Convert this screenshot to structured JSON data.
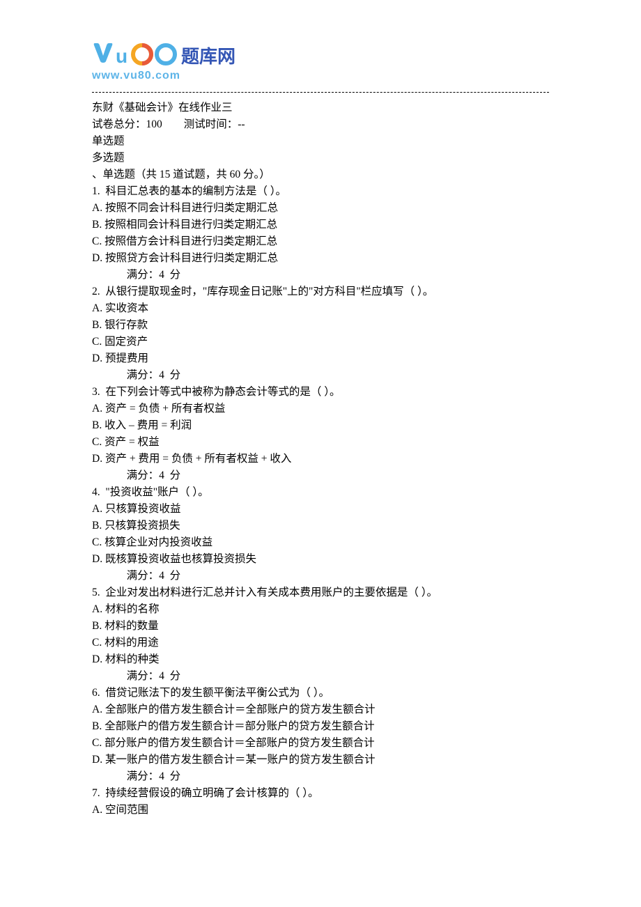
{
  "logo": {
    "text_cn": "题库网",
    "domain": "www.vu80.com"
  },
  "header": {
    "title": "东财《基础会计》在线作业三",
    "score_label": "试卷总分：100",
    "time_label": "测试时间：--",
    "single_choice_label": "单选题",
    "multi_choice_label": "多选题",
    "section_header": "、单选题（共 15 道试题，共 60 分。）"
  },
  "questions": [
    {
      "stem": "1.  科目汇总表的基本的编制方法是（ ）。",
      "options": [
        "A. 按照不同会计科目进行归类定期汇总",
        "B. 按照相同会计科目进行归类定期汇总",
        "C. 按照借方会计科目进行归类定期汇总",
        "D. 按照贷方会计科目进行归类定期汇总"
      ],
      "score": "满分：4  分"
    },
    {
      "stem": "2.  从银行提取现金时，\"库存现金日记账\"上的\"对方科目\"栏应填写（ ）。",
      "options": [
        "A. 实收资本",
        "B. 银行存款",
        "C. 固定资产",
        "D. 预提费用"
      ],
      "score": "满分：4  分"
    },
    {
      "stem": "3.  在下列会计等式中被称为静态会计等式的是（ ）。",
      "options": [
        "A. 资产 = 负债 + 所有者权益",
        "B. 收入 – 费用 = 利润",
        "C. 资产 = 权益",
        "D. 资产 + 费用 = 负债 + 所有者权益 + 收入"
      ],
      "score": "满分：4  分"
    },
    {
      "stem": "4.  \"投资收益\"账户（ ）。",
      "options": [
        "A. 只核算投资收益",
        "B. 只核算投资损失",
        "C. 核算企业对内投资收益",
        "D. 既核算投资收益也核算投资损失"
      ],
      "score": "满分：4  分"
    },
    {
      "stem": "5.  企业对发出材料进行汇总并计入有关成本费用账户的主要依据是（ ）。",
      "options": [
        "A. 材料的名称",
        "B. 材料的数量",
        "C. 材料的用途",
        "D. 材料的种类"
      ],
      "score": "满分：4  分"
    },
    {
      "stem": "6.  借贷记账法下的发生额平衡法平衡公式为（ ）。",
      "options": [
        "A. 全部账户的借方发生额合计＝全部账户的贷方发生额合计",
        "B. 全部账户的借方发生额合计＝部分账户的贷方发生额合计",
        "C. 部分账户的借方发生额合计＝全部账户的贷方发生额合计",
        "D. 某一账户的借方发生额合计＝某一账户的贷方发生额合计"
      ],
      "score": "满分：4  分"
    },
    {
      "stem": "7.  持续经营假设的确立明确了会计核算的（ ）。",
      "options": [
        "A. 空间范围"
      ],
      "score": null
    }
  ]
}
